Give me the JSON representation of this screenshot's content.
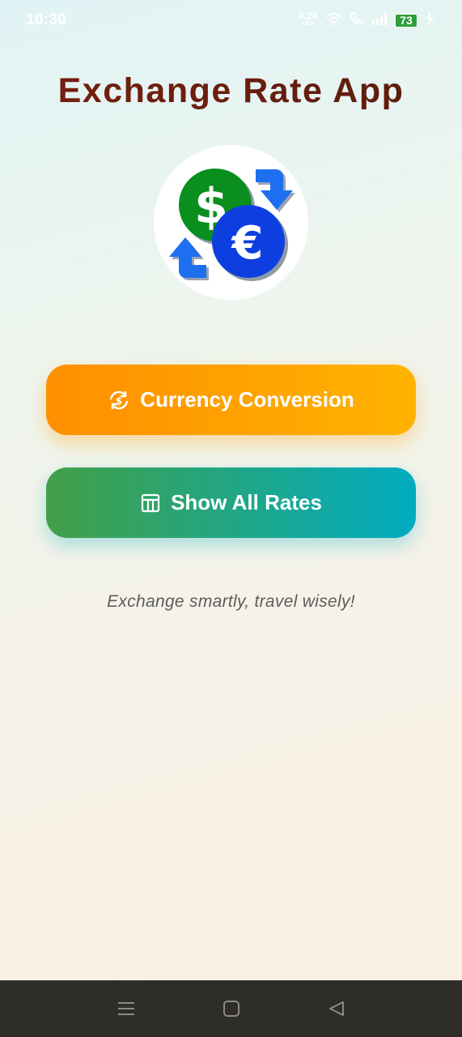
{
  "status_bar": {
    "time": "10:30",
    "net_speed_value": "0.24",
    "net_speed_unit": "KB/S",
    "battery": "73"
  },
  "app": {
    "title": "Exchange Rate App"
  },
  "buttons": {
    "convert_label": "Currency Conversion",
    "rates_label": "Show All Rates"
  },
  "tagline": "Exchange smartly, travel wisely!",
  "colors": {
    "title": "#6b1e0e",
    "convert_gradient_start": "#ff8f00",
    "convert_gradient_end": "#ffb300",
    "rates_gradient_start": "#43a047",
    "rates_gradient_end": "#00acc1",
    "dollar_coin": "#0a8f1f",
    "euro_coin": "#0d3fe0",
    "arrow": "#1e6ff0"
  }
}
